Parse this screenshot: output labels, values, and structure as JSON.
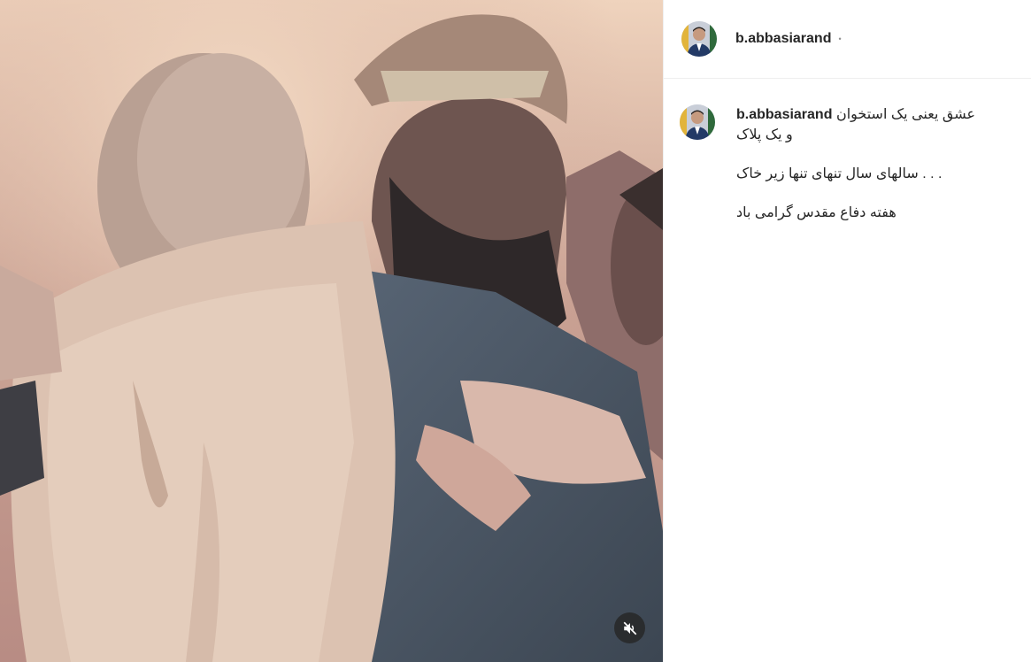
{
  "post": {
    "author": {
      "username": "b.abbasiarand",
      "separator_dot": "•"
    },
    "caption": {
      "username": "b.abbasiarand",
      "first_text": "عشق یعنی یک استخوان",
      "second_text": "و یک پلاک",
      "line2": "سالهای سال تنهای تنها زیر خاک . . .",
      "line3": "هفته دفاع مقدس گرامی باد"
    }
  },
  "media": {
    "type": "video",
    "muted": true,
    "mute_icon": "speaker-muted-icon"
  },
  "colors": {
    "text_primary": "#262626",
    "divider": "#efefef",
    "mute_button_bg": "#262626"
  }
}
